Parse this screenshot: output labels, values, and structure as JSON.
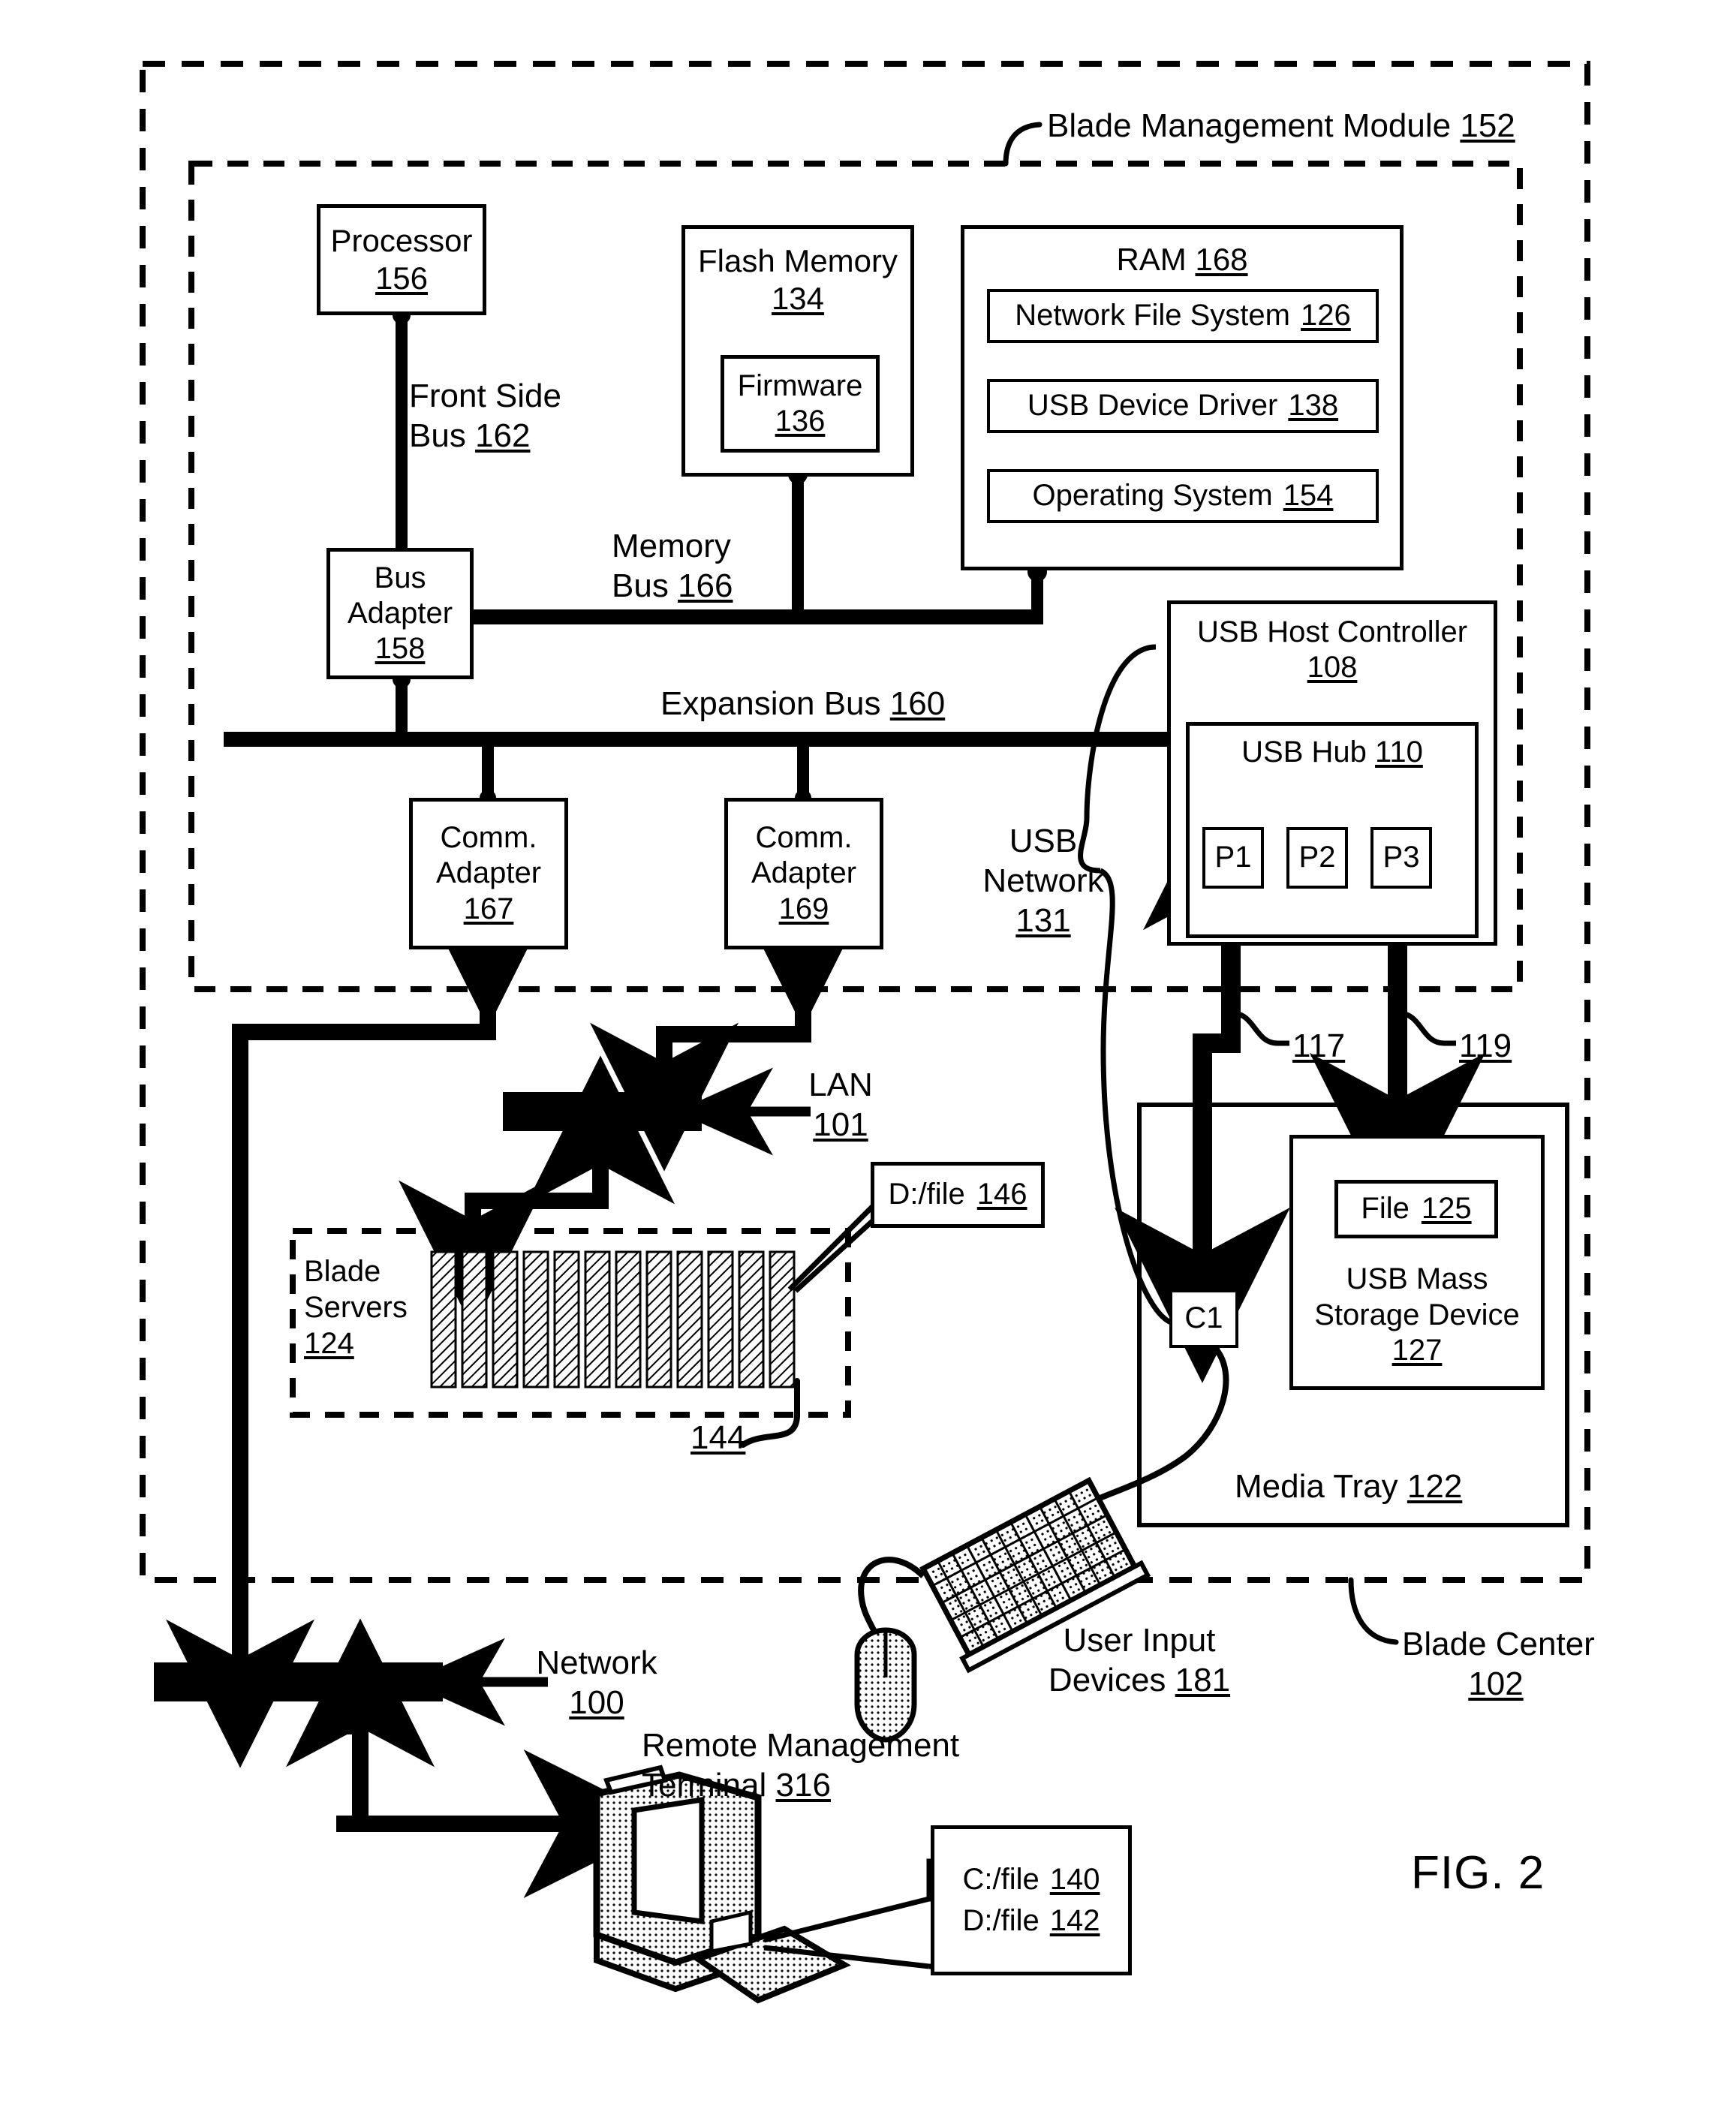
{
  "figure": {
    "caption": "FIG. 2"
  },
  "containers": {
    "blade_center": {
      "label": "Blade Center",
      "ref": "102"
    },
    "blade_management_module": {
      "label": "Blade Management Module",
      "ref": "152"
    },
    "blade_servers": {
      "label_line1": "Blade",
      "label_line2": "Servers",
      "ref": "124"
    },
    "media_tray": {
      "label": "Media Tray",
      "ref": "122"
    }
  },
  "boxes": {
    "processor": {
      "label": "Processor",
      "ref": "156"
    },
    "flash_memory": {
      "label": "Flash Memory",
      "ref": "134"
    },
    "firmware": {
      "label": "Firmware",
      "ref": "136"
    },
    "ram": {
      "label": "RAM",
      "ref": "168"
    },
    "network_file_system": {
      "label": "Network File System",
      "ref": "126"
    },
    "usb_device_driver": {
      "label": "USB Device Driver",
      "ref": "138"
    },
    "operating_system": {
      "label": "Operating System",
      "ref": "154"
    },
    "bus_adapter": {
      "label_line1": "Bus",
      "label_line2": "Adapter",
      "ref": "158"
    },
    "comm_adapter_167": {
      "label_line1": "Comm.",
      "label_line2": "Adapter",
      "ref": "167"
    },
    "comm_adapter_169": {
      "label_line1": "Comm.",
      "label_line2": "Adapter",
      "ref": "169"
    },
    "usb_host_controller": {
      "label": "USB Host Controller",
      "ref": "108"
    },
    "usb_hub": {
      "label": "USB Hub",
      "ref": "110"
    },
    "port_p1": {
      "label": "P1"
    },
    "port_p2": {
      "label": "P2"
    },
    "port_p3": {
      "label": "P3"
    },
    "connector_c1": {
      "label": "C1"
    },
    "usb_mass_storage": {
      "label_line1": "USB Mass",
      "label_line2": "Storage Device",
      "ref": "127"
    },
    "file_125": {
      "label": "File",
      "ref": "125"
    },
    "callout_d_file_146": {
      "label": "D:/file",
      "ref": "146"
    },
    "terminal_files": {
      "line1_label": "C:/file",
      "line1_ref": "140",
      "line2_label": "D:/file",
      "line2_ref": "142"
    }
  },
  "buses": {
    "front_side_bus": {
      "line1": "Front Side",
      "line2": "Bus",
      "ref": "162"
    },
    "memory_bus": {
      "line1": "Memory",
      "line2": "Bus",
      "ref": "166"
    },
    "expansion_bus": {
      "label": "Expansion Bus",
      "ref": "160"
    },
    "usb_network": {
      "line1": "USB",
      "line2": "Network",
      "ref": "131"
    }
  },
  "networks": {
    "lan": {
      "label": "LAN",
      "ref": "101"
    },
    "network": {
      "label": "Network",
      "ref": "100"
    }
  },
  "devices": {
    "user_input_devices": {
      "line1": "User Input",
      "line2": "Devices",
      "ref": "181"
    },
    "remote_management_terminal": {
      "line1": "Remote Management",
      "line2": "Terminal",
      "ref": "316"
    }
  },
  "refs": {
    "usb_link_117": "117",
    "usb_link_119": "119",
    "blade_server_144": "144"
  }
}
